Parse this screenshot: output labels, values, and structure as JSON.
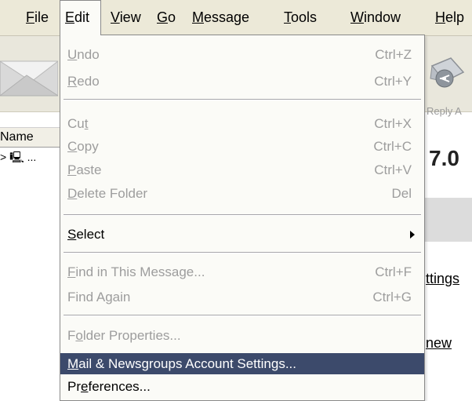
{
  "menubar": {
    "items": [
      {
        "label": "File",
        "mnemonic": "F",
        "rest": "ile"
      },
      {
        "label": "Edit",
        "mnemonic": "E",
        "rest": "dit"
      },
      {
        "label": "View",
        "mnemonic": "V",
        "rest": "iew"
      },
      {
        "label": "Go",
        "mnemonic": "G",
        "rest": "o"
      },
      {
        "label": "Message",
        "mnemonic": "M",
        "rest": "essage"
      },
      {
        "label": "Tools",
        "mnemonic": "T",
        "rest": "ools"
      },
      {
        "label": "Window",
        "mnemonic": "W",
        "rest": "indow"
      },
      {
        "label": "Help",
        "mnemonic": "H",
        "rest": "elp"
      }
    ],
    "active": "Edit"
  },
  "toolbar": {
    "reply_label": "Reply A"
  },
  "folder_pane": {
    "header": "Name",
    "row_text": "> 🖳 ..."
  },
  "content": {
    "version_text": "7.0",
    "link_settings": "ttings",
    "link_new": "new"
  },
  "edit_menu": {
    "items": [
      {
        "pre": "",
        "mn": "U",
        "post": "ndo",
        "shortcut": "Ctrl+Z",
        "state": "disabled"
      },
      {
        "pre": "",
        "mn": "R",
        "post": "edo",
        "shortcut": "Ctrl+Y",
        "state": "disabled"
      },
      {
        "pre": "Cu",
        "mn": "t",
        "post": "",
        "shortcut": "Ctrl+X",
        "state": "disabled"
      },
      {
        "pre": "",
        "mn": "C",
        "post": "opy",
        "shortcut": "Ctrl+C",
        "state": "disabled"
      },
      {
        "pre": "",
        "mn": "P",
        "post": "aste",
        "shortcut": "Ctrl+V",
        "state": "disabled"
      },
      {
        "pre": "",
        "mn": "D",
        "post": "elete Folder",
        "shortcut": "Del",
        "state": "disabled"
      },
      {
        "pre": "",
        "mn": "S",
        "post": "elect",
        "shortcut": "",
        "state": "enabled"
      },
      {
        "pre": "",
        "mn": "F",
        "post": "ind in This Message...",
        "shortcut": "Ctrl+F",
        "state": "disabled"
      },
      {
        "pre": "Find Again",
        "mn": "",
        "post": "",
        "shortcut": "Ctrl+G",
        "state": "disabled"
      },
      {
        "pre": "F",
        "mn": "o",
        "post": "lder Properties...",
        "shortcut": "",
        "state": "disabled"
      },
      {
        "pre": "",
        "mn": "M",
        "post": "ail & Newsgroups Account Settings...",
        "shortcut": "",
        "state": "highlight"
      },
      {
        "pre": "Pr",
        "mn": "e",
        "post": "ferences...",
        "shortcut": "",
        "state": "enabled"
      }
    ]
  },
  "colors": {
    "menubar_bg": "#ece9d8",
    "menu_bg": "#fbfbf7",
    "highlight_bg": "#3c4a6b",
    "disabled_text": "#9d9d9d"
  }
}
